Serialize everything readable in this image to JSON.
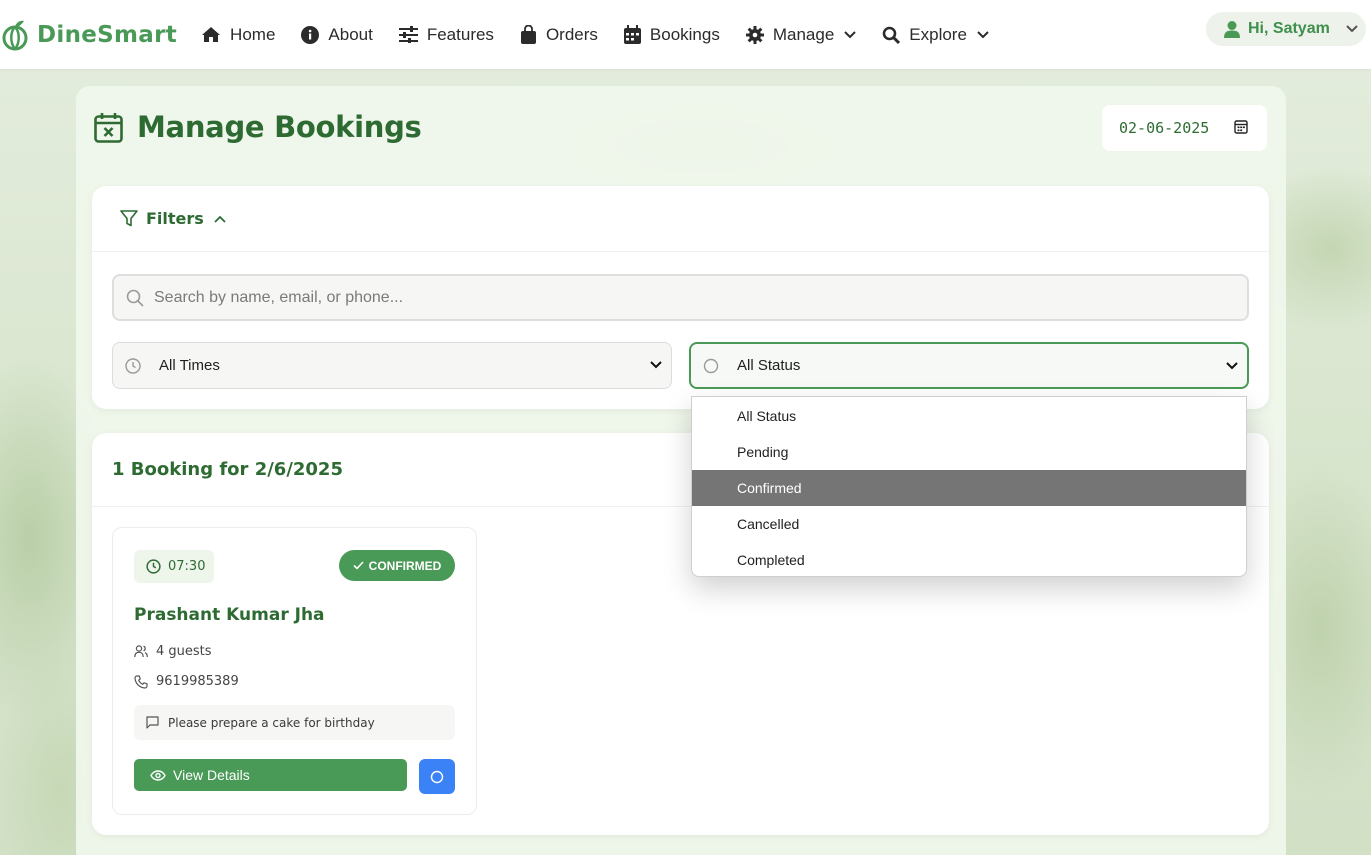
{
  "brand": {
    "name": "DineSmart",
    "color": "#4a9a57"
  },
  "nav": {
    "items": [
      {
        "label": "Home",
        "icon": "home-icon"
      },
      {
        "label": "About",
        "icon": "info-icon"
      },
      {
        "label": "Features",
        "icon": "sliders-icon"
      },
      {
        "label": "Orders",
        "icon": "shopping-bag-icon"
      },
      {
        "label": "Bookings",
        "icon": "calendar-icon"
      },
      {
        "label": "Manage",
        "icon": "gear-icon"
      },
      {
        "label": "Explore",
        "icon": "search-icon"
      }
    ],
    "user_label": "Hi, Satyam"
  },
  "page": {
    "title": "Manage Bookings",
    "date_value": "02-06-2025"
  },
  "filters": {
    "label": "Filters",
    "search_placeholder": "Search by name, email, or phone...",
    "time_select": "All Times",
    "status_select": "All Status",
    "status_options": [
      "All Status",
      "Pending",
      "Confirmed",
      "Cancelled",
      "Completed"
    ],
    "highlighted_option": "Confirmed"
  },
  "results": {
    "heading": "1 Booking for 2/6/2025",
    "bookings": [
      {
        "time": "07:30",
        "status": "CONFIRMED",
        "name": "Prashant Kumar Jha",
        "guests": "4 guests",
        "phone": "9619985389",
        "note": "Please prepare a cake for birthday",
        "view_label": "View Details"
      }
    ]
  },
  "colors": {
    "accent": "#4a9a57",
    "heading": "#2e6b33",
    "action_blue": "#3b82f6",
    "option_highlight": "#757575"
  }
}
